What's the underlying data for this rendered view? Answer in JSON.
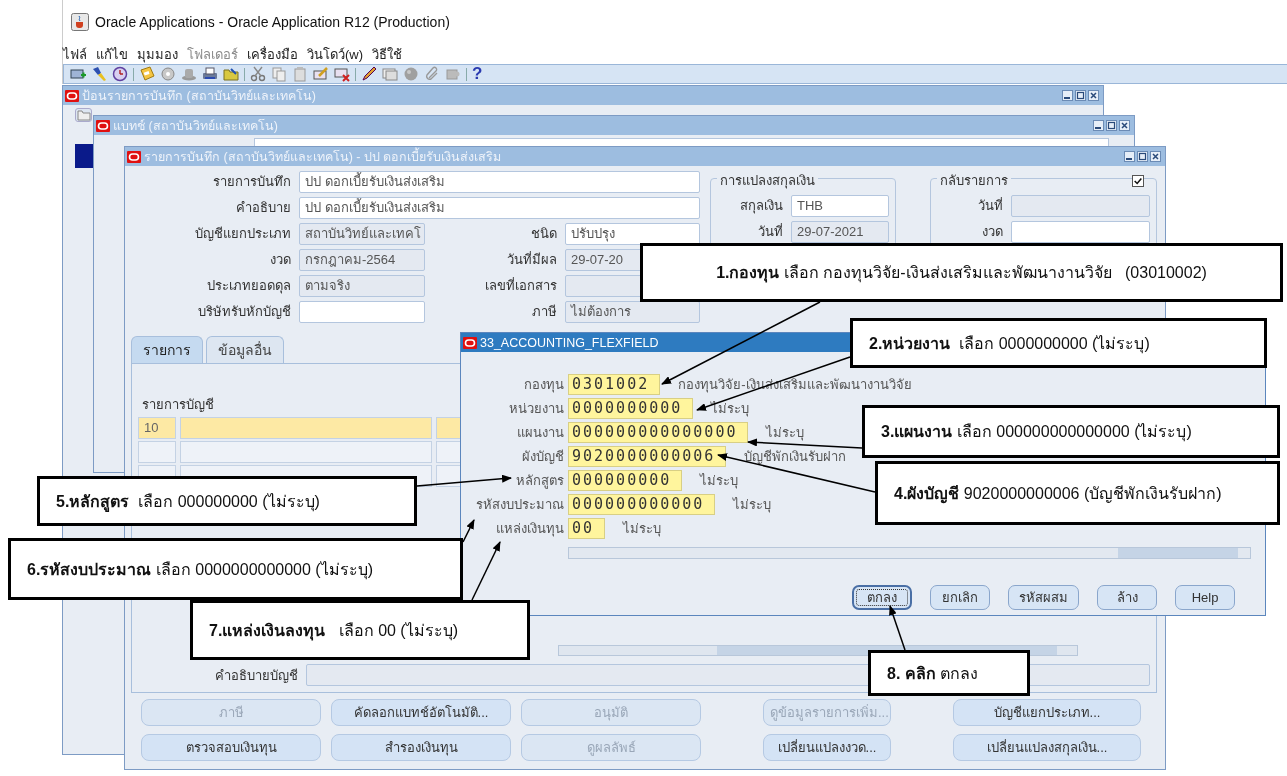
{
  "app": {
    "title": "Oracle Applications - Oracle Application R12 (Production)"
  },
  "menu": [
    {
      "label": "ไฟล์",
      "disabled": false
    },
    {
      "label": "แก้ไข",
      "disabled": false
    },
    {
      "label": "มุมมอง",
      "disabled": false
    },
    {
      "label": "โฟลเดอร์",
      "disabled": true
    },
    {
      "label": "เครื่องมือ",
      "disabled": false
    },
    {
      "label": "วินโดว์(w)",
      "disabled": false
    },
    {
      "label": "วิธีใช้",
      "disabled": false
    }
  ],
  "toolbar": {
    "help": "?"
  },
  "windows": [
    {
      "title": "ป้อนรายการบันทึก (สถาบันวิทย์และเทคโน)"
    },
    {
      "title": "แบทช์ (สถาบันวิทย์และเทคโน)"
    }
  ],
  "journal": {
    "title": "รายการบันทึก (สถาบันวิทย์และเทคโน) - ปป ดอกเบี้ยรับเงินส่งเสริม",
    "fields": [
      {
        "label": "รายการบันทึก",
        "value": "ปป ดอกเบี้ยรับเงินส่งเสริม",
        "readonly": false
      },
      {
        "label": "คำอธิบาย",
        "value": "ปป ดอกเบี้ยรับเงินส่งเสริม",
        "readonly": false
      },
      {
        "label": "บัญชีแยกประเภท",
        "value": "สถาบันวิทย์และเทคโ",
        "readonly": true
      },
      {
        "label": "งวด",
        "value": "กรกฎาคม-2564",
        "readonly": true
      },
      {
        "label": "ประเภทยอดดุล",
        "value": "ตามจริง",
        "readonly": true
      },
      {
        "label": "บริษัทรับหักบัญชี",
        "readonly": false
      }
    ],
    "fields_right": [
      {
        "label": "ชนิด",
        "value": "ปรับปรุง",
        "readonly": false
      },
      {
        "label": "วันที่มีผล",
        "value": "29-07-20",
        "readonly": true
      },
      {
        "label": "เลขที่เอกสาร",
        "readonly": true
      },
      {
        "label": "ภาษี",
        "value": "ไม่ต้องการ",
        "readonly": true
      }
    ],
    "currency": {
      "title": "การแปลงสกุลเงิน",
      "fields": [
        {
          "label": "สกุลเงิน",
          "value": "THB",
          "readonly": false
        },
        {
          "label": "วันที่",
          "value": "29-07-2021",
          "readonly": true
        }
      ]
    },
    "reverse": {
      "title": "กลับรายการ",
      "checked": true,
      "fields": [
        {
          "label": "วันที่",
          "readonly": true
        },
        {
          "label": "งวด",
          "readonly": false
        }
      ]
    },
    "tabs": [
      {
        "label": "รายการ",
        "selected": true
      },
      {
        "label": "ข้อมูลอื่น",
        "selected": false
      }
    ],
    "lines": {
      "heading": "รายการบัญชี",
      "rows": [
        {
          "line": "10",
          "selected": true
        },
        {
          "selected": false
        },
        {
          "selected": false
        }
      ]
    },
    "account_description": {
      "label": "คำอธิบายบัญชี"
    },
    "buttons": [
      [
        {
          "label": "ภาษี",
          "disabled": true
        },
        {
          "label": "คัดลอกแบทช์อัตโนมัติ...",
          "disabled": false
        },
        {
          "label": "อนุมัติ",
          "disabled": true
        },
        {
          "label": "ดูข้อมูลรายการเพิ่ม...",
          "disabled": true
        },
        {
          "label": "บัญชีแยกประเภท...",
          "disabled": false
        }
      ],
      [
        {
          "label": "ตรวจสอบเงินทุน",
          "disabled": false
        },
        {
          "label": "สำรองเงินทุน",
          "disabled": false
        },
        {
          "label": "ดูผลลัพธ์",
          "disabled": true
        },
        {
          "label": "เปลี่ยนแปลงงวด...",
          "disabled": false
        },
        {
          "label": "เปลี่ยนแปลงสกุลเงิน...",
          "disabled": false
        }
      ]
    ]
  },
  "flexfield": {
    "title": "33_ACCOUNTING_FLEXFIELD",
    "segments": [
      {
        "label": "กองทุน",
        "value": "0301002",
        "description": "กองทุนวิจัย-เงินส่งเสริมและพัฒนางานวิจัย"
      },
      {
        "label": "หน่วยงาน",
        "value": "0000000000",
        "description": "ไม่ระบุ"
      },
      {
        "label": "แผนงาน",
        "value": "000000000000000",
        "description": "ไม่ระบุ"
      },
      {
        "label": "ผังบัญชี",
        "value": "9020000000006",
        "description": "บัญชีพักเงินรับฝาก"
      },
      {
        "label": "หลักสูตร",
        "value": "000000000",
        "description": "ไม่ระบุ"
      },
      {
        "label": "รหัสงบประมาณ",
        "value": "000000000000",
        "description": "ไม่ระบุ"
      },
      {
        "label": "แหล่งเงินทุน",
        "value": "00",
        "description": "ไม่ระบุ"
      }
    ],
    "buttons": [
      {
        "label": "ตกลง",
        "focused": true
      },
      {
        "label": "ยกเลิก",
        "focused": false
      },
      {
        "label": "รหัสผสม",
        "focused": false
      },
      {
        "label": "ล้าง",
        "focused": false
      },
      {
        "label": "Help",
        "focused": false
      }
    ]
  },
  "callouts": [
    {
      "text": "**1.กองทุน** เลือก กองทุนวิจัย-เงินส่งเสริมและพัฒนางานวิจัย   (03010002)"
    },
    {
      "text": "**2.หน่วยงาน**  เลือก 0000000000 (ไม่ระบุ)"
    },
    {
      "text": "**3.แผนงาน** เลือก 000000000000000 (ไม่ระบุ)"
    },
    {
      "text": "**4.ผังบัญชี** 9020000000006 (บัญชีพักเงินรับฝาก)"
    },
    {
      "text": "**5.หลักสูตร**  เลือก 000000000 (ไม่ระบุ)"
    },
    {
      "text": "**6.รหัสงบประมาณ** เลือก 0000000000000 (ไม่ระบุ)"
    },
    {
      "text": "**7.แหล่งเงินลงทุน**   เลือก 00 (ไม่ระบุ)"
    },
    {
      "text": "**8. คลิก** ตกลง"
    }
  ]
}
